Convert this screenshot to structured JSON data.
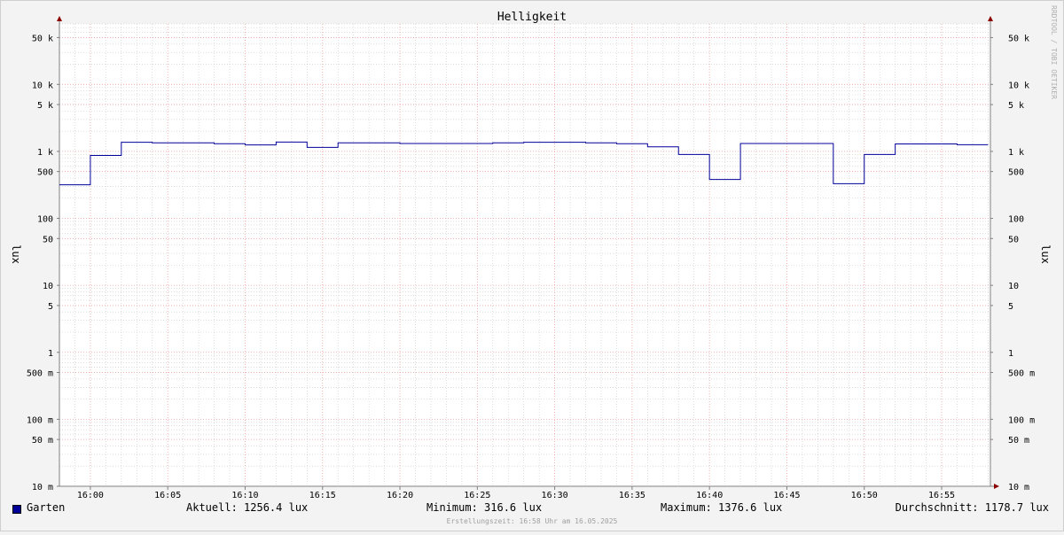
{
  "chart_data": {
    "type": "line",
    "title": "Helligkeit",
    "ylabel_left": "lux",
    "ylabel_right": "lux",
    "y_scale": "log",
    "ylim": [
      0.01,
      80000
    ],
    "y_ticks": [
      {
        "value": 50000,
        "label": "50 k"
      },
      {
        "value": 10000,
        "label": "10 k"
      },
      {
        "value": 5000,
        "label": "5 k"
      },
      {
        "value": 1000,
        "label": "1 k"
      },
      {
        "value": 500,
        "label": "500"
      },
      {
        "value": 100,
        "label": "100"
      },
      {
        "value": 50,
        "label": "50"
      },
      {
        "value": 10,
        "label": "10"
      },
      {
        "value": 5,
        "label": "5"
      },
      {
        "value": 1,
        "label": "1"
      },
      {
        "value": 0.5,
        "label": "500 m"
      },
      {
        "value": 0.1,
        "label": "100 m"
      },
      {
        "value": 0.05,
        "label": "50 m"
      },
      {
        "value": 0.01,
        "label": "10 m"
      }
    ],
    "xlim": [
      "15:58",
      "17:58"
    ],
    "x_ticks": [
      "16:00",
      "16:05",
      "16:10",
      "16:15",
      "16:20",
      "16:25",
      "16:30",
      "16:35",
      "16:40",
      "16:45",
      "16:50",
      "16:55"
    ],
    "grid": true,
    "series": [
      {
        "name": "Garten",
        "color": "#000099",
        "step": true,
        "points": [
          {
            "x": "15:58",
            "y": 316.6
          },
          {
            "x": "16:00",
            "y": 870
          },
          {
            "x": "16:02",
            "y": 1370
          },
          {
            "x": "16:04",
            "y": 1340
          },
          {
            "x": "16:08",
            "y": 1300
          },
          {
            "x": "16:10",
            "y": 1250
          },
          {
            "x": "16:12",
            "y": 1376.6
          },
          {
            "x": "16:14",
            "y": 1150
          },
          {
            "x": "16:16",
            "y": 1340
          },
          {
            "x": "16:20",
            "y": 1310
          },
          {
            "x": "16:26",
            "y": 1340
          },
          {
            "x": "16:28",
            "y": 1370
          },
          {
            "x": "16:32",
            "y": 1340
          },
          {
            "x": "16:34",
            "y": 1300
          },
          {
            "x": "16:36",
            "y": 1170
          },
          {
            "x": "16:38",
            "y": 900
          },
          {
            "x": "16:40",
            "y": 380
          },
          {
            "x": "16:42",
            "y": 1310
          },
          {
            "x": "16:48",
            "y": 330
          },
          {
            "x": "16:50",
            "y": 900
          },
          {
            "x": "16:52",
            "y": 1290
          },
          {
            "x": "16:56",
            "y": 1256.4
          },
          {
            "x": "16:58",
            "y": 1256.4
          }
        ]
      }
    ]
  },
  "legend": {
    "series_name": "Garten",
    "current": "Aktuell: 1256.4 lux",
    "minimum": "Minimum: 316.6 lux",
    "maximum": "Maximum: 1376.6 lux",
    "average": "Durchschnitt: 1178.7 lux"
  },
  "footer": "Erstellungszeit: 16:58 Uhr am 16.05.2025",
  "watermark": "RRDTOOL / TOBI OETIKER",
  "colors": {
    "series": "#000099",
    "major_grid": "#f0a0a0",
    "minor_grid": "#c8c8c8",
    "axis": "#808080",
    "arrow": "#8b0000",
    "plot_background": "#ffffff",
    "canvas_background": "#f3f3f3"
  }
}
